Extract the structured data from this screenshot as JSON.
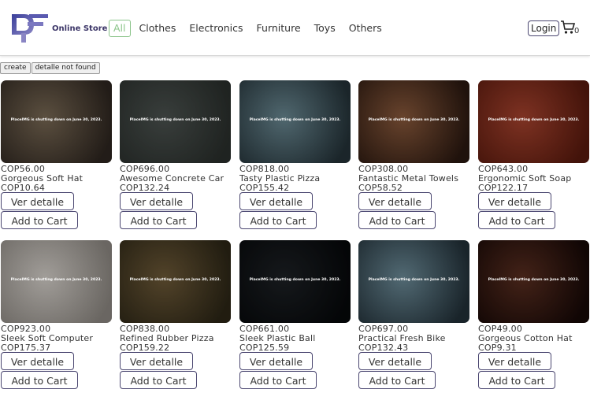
{
  "brand": {
    "name": "Online Store"
  },
  "nav": {
    "items": [
      "All",
      "Clothes",
      "Electronics",
      "Furniture",
      "Toys",
      "Others"
    ],
    "active": "All"
  },
  "header": {
    "login_label": "Login",
    "cart_count": "0"
  },
  "toolbar": {
    "create_label": "create",
    "detail_label": "detalle not found"
  },
  "image_notice": "PlaceIMG is shutting down on June 30, 2023.",
  "buttons": {
    "detail": "Ver detalle",
    "add": "Add to Cart"
  },
  "products": [
    {
      "price": "COP56.00",
      "name": "Gorgeous Soft Hat",
      "old": "COP10.64",
      "palette": [
        "#7a6a55",
        "#2e2620"
      ]
    },
    {
      "price": "COP696.00",
      "name": "Awesome Concrete Car",
      "old": "COP132.24",
      "palette": [
        "#4c5350",
        "#2a2f2c"
      ]
    },
    {
      "price": "COP818.00",
      "name": "Tasty Plastic Pizza",
      "old": "COP155.42",
      "palette": [
        "#6b8a94",
        "#243238"
      ]
    },
    {
      "price": "COP308.00",
      "name": "Fantastic Metal Towels",
      "old": "COP58.52",
      "palette": [
        "#8b5a3c",
        "#2a1810"
      ]
    },
    {
      "price": "COP643.00",
      "name": "Ergonomic Soft Soap",
      "old": "COP122.17",
      "palette": [
        "#a8432e",
        "#5a1a0e"
      ]
    },
    {
      "price": "COP923.00",
      "name": "Sleek Soft Computer",
      "old": "COP175.37",
      "palette": [
        "#d7d2cc",
        "#8e8983"
      ]
    },
    {
      "price": "COP838.00",
      "name": "Refined Rubber Pizza",
      "old": "COP159.22",
      "palette": [
        "#6e5a38",
        "#2c2616"
      ]
    },
    {
      "price": "COP661.00",
      "name": "Sleek Plastic Ball",
      "old": "COP125.59",
      "palette": [
        "#1d2125",
        "#06080a"
      ]
    },
    {
      "price": "COP697.00",
      "name": "Practical Fresh Bike",
      "old": "COP132.43",
      "palette": [
        "#6d8d9a",
        "#223038"
      ]
    },
    {
      "price": "COP49.00",
      "name": "Gorgeous Cotton Hat",
      "old": "COP9.31",
      "palette": [
        "#5a2e20",
        "#160806"
      ]
    }
  ]
}
